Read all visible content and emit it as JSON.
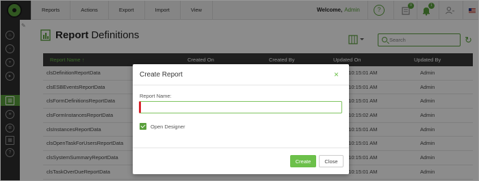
{
  "topbar": {
    "menu": [
      "Reports",
      "Actions",
      "Export",
      "Import",
      "View"
    ],
    "welcome_label": "Welcome,",
    "welcome_user": "Admin",
    "help_icon": "question-circle-icon",
    "tasks_badge": "0",
    "notifications_badge": "1"
  },
  "page": {
    "title_bold": "Report",
    "title_rest": "Definitions"
  },
  "search": {
    "placeholder": "Search"
  },
  "table": {
    "columns": [
      "Report Name",
      "Created On",
      "Created By",
      "Updated On",
      "Updated By"
    ],
    "sort_column": "Report Name",
    "rows": [
      {
        "name": "clsDefinitionReportData",
        "updated_on": "9 10:15:01 AM",
        "updated_by": "Admin"
      },
      {
        "name": "clsESBEventsReportData",
        "updated_on": "9 10:15:01 AM",
        "updated_by": "Admin"
      },
      {
        "name": "clsFormDefinitionsReportData",
        "updated_on": "9 10:15:01 AM",
        "updated_by": "Admin"
      },
      {
        "name": "clsFormInstancesReportData",
        "updated_on": "9 10:15:02 AM",
        "updated_by": "Admin"
      },
      {
        "name": "clsInstancesReportData",
        "updated_on": "9 10:15:01 AM",
        "updated_by": "Admin"
      },
      {
        "name": "clsOpenTaskForUsersReportData",
        "updated_on": "9 10:15:01 AM",
        "updated_by": "Admin"
      },
      {
        "name": "clsSystemSummaryReportData",
        "updated_on": "9 10:15:01 AM",
        "updated_by": "Admin"
      },
      {
        "name": "clsTaskOverDueReportData",
        "updated_on": "9 10:15:01 AM",
        "updated_by": "Admin"
      }
    ]
  },
  "modal": {
    "title": "Create Report",
    "close_glyph": "×",
    "field_label": "Report Name:",
    "field_value": "",
    "checkbox_label": "Open Designer",
    "checkbox_checked": true,
    "create_label": "Create",
    "close_label": "Close"
  },
  "colors": {
    "accent": "#5aa03c",
    "accent_light": "#6cc04a",
    "sidebar_bg": "#2e2e2e",
    "table_header_bg": "#3a3a3a",
    "required_marker": "#d9232d"
  }
}
